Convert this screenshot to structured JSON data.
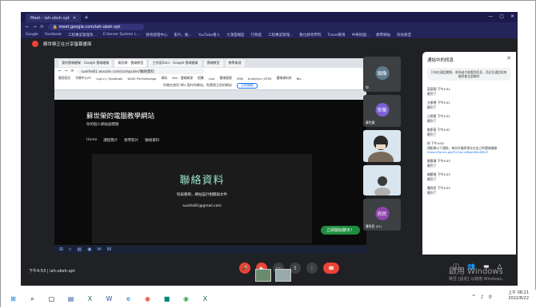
{
  "window": {
    "tab_title": "Meet - iah-ubsh-xpt",
    "url": "meet.google.com/iah-ubsh-xpt",
    "bookmarks": [
      "Google",
      "Facebook",
      "工程專案管理系...",
      "E-Server System L...",
      "教育部雲中心",
      "影片、動...",
      "YouTube看人",
      "大漢雲端區",
      "行政區",
      "工程專案管理...",
      "數位教育學院",
      "Travel教育",
      "中華民國...",
      "教學網站",
      "科技教室"
    ]
  },
  "meet_banner": "蘇世榮正在分享螢幕畫面",
  "inner": {
    "tabs": [
      "我的雲端硬碟 - Google 雲端硬碟",
      "資訊網 - 雲端教室",
      "工作區Docs - Google 雲端硬碟",
      "雲端教室",
      "教學資源"
    ],
    "url": "sueifei81.wixsite.com/computer/聯絡資料",
    "bookmarks": [
      "應用程式",
      "代碼中心PC",
      "Log in | Facebook",
      "WGJS PinVisitorage",
      "資料",
      "Wix - 雲端資源",
      "相簿",
      "Line",
      "雲端管理",
      "VRN",
      "Analytics (GTM)",
      "雲端資料夾",
      "Blo"
    ],
    "notice": "你開在使用 Wix 製作的網站。免費建立您的網站",
    "notice_btn": "立即開始",
    "site_title": "蘇世榮的電腦教學網站",
    "site_sub": "你的個人網站副標題",
    "nav": [
      "Home",
      "課程簡介",
      "教學影片",
      "聯絡資料"
    ],
    "contact_title": "聯絡資料",
    "contact_desc": "科技教師，網站設計相關與文件",
    "contact_email": "sueifei81@gmail.com",
    "start_button": "立即開始聊天！"
  },
  "participants": [
    {
      "name": "你",
      "avatar": "頭像"
    },
    {
      "name": "蘇世榮",
      "avatar": "世榮"
    },
    {
      "name": "",
      "avatar": ""
    },
    {
      "name": "",
      "avatar": ""
    },
    {
      "name": "羅尚民 (21)",
      "avatar": "尚民"
    }
  ],
  "chat": {
    "title": "通話中的訊息",
    "note": "只有在通話期間，參與者才能看到訊息，而且在通話結束後將會全部刪除",
    "messages": [
      {
        "who": "莊庭翔 下午4:51",
        "txt": "聽到了"
      },
      {
        "who": "方俊德 下午4:51",
        "txt": "聽到了"
      },
      {
        "who": "江佩萱 下午4:51",
        "txt": "聽到了"
      },
      {
        "who": "劉家豪 下午4:52",
        "txt": "聽到了"
      },
      {
        "who": "你 下午4:52",
        "txt": "請點擊以下連結，每份作業將保存在自己的雲端硬碟",
        "link": "https://forms.gle/TnCwLx4Bpm9KvMSd7"
      },
      {
        "who": "劉鳳偉 下午4:53",
        "txt": "聽到了"
      },
      {
        "who": "謝碧瑤 下午4:53",
        "txt": "聽到了"
      },
      {
        "who": "羅尚民 下午4:53",
        "txt": "聽到了"
      }
    ],
    "input_placeholder": "傳送訊息"
  },
  "meet_bottom": {
    "time_code": "下午4:53",
    "meeting_code": "iah-ubsh-xpt"
  },
  "windows_watermark": {
    "line1": "啟用 Windows",
    "line2": "移至 [設定] 以啟用 Windows。"
  },
  "tray": {
    "time": "上午 08:21",
    "date": "2022/8/22"
  }
}
